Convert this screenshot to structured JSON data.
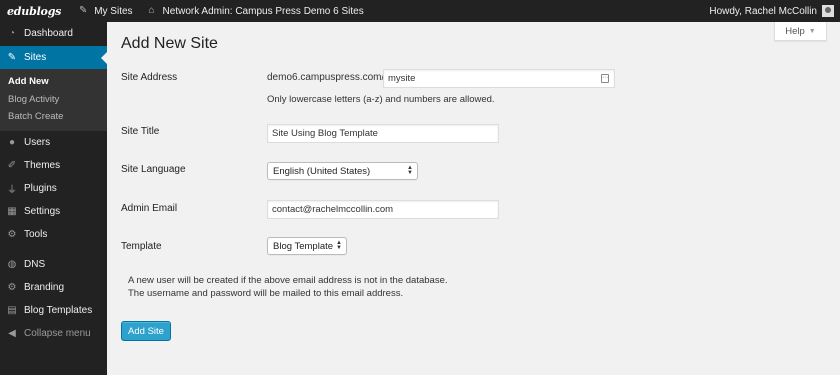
{
  "adminbar": {
    "logo": "edublogs",
    "my_sites": "My Sites",
    "network": "Network Admin: Campus Press Demo 6 Sites",
    "howdy": "Howdy, Rachel McCollin"
  },
  "sidebar": {
    "items": [
      {
        "label": "Dashboard",
        "icon": "dashboard-icon"
      },
      {
        "label": "Sites",
        "icon": "wrench-icon"
      },
      {
        "label": "Users",
        "icon": "user-icon"
      },
      {
        "label": "Themes",
        "icon": "paintbrush-icon"
      },
      {
        "label": "Plugins",
        "icon": "plug-icon"
      },
      {
        "label": "Settings",
        "icon": "settings-icon"
      },
      {
        "label": "Tools",
        "icon": "gear-icon"
      },
      {
        "label": "DNS",
        "icon": "globe-icon"
      },
      {
        "label": "Branding",
        "icon": "gear-icon"
      },
      {
        "label": "Blog Templates",
        "icon": "grid-icon"
      }
    ],
    "submenu": [
      "Add New",
      "Blog Activity",
      "Batch Create"
    ],
    "collapse": "Collapse menu"
  },
  "help": {
    "label": "Help"
  },
  "page": {
    "title": "Add New Site",
    "site_address_label": "Site Address",
    "site_address_prefix": "demo6.campuspress.com/",
    "site_address_value": "mysite",
    "site_address_hint": "Only lowercase letters (a-z) and numbers are allowed.",
    "site_title_label": "Site Title",
    "site_title_value": "Site Using Blog Template",
    "language_label": "Site Language",
    "language_value": "English (United States)",
    "admin_email_label": "Admin Email",
    "admin_email_value": "contact@rachelmccollin.com",
    "template_label": "Template",
    "template_value": "Blog Template",
    "note_line1": "A new user will be created if the above email address is not in the database.",
    "note_line2": "The username and password will be mailed to this email address.",
    "submit_label": "Add Site"
  },
  "colors": {
    "adminbar_bg": "#222222",
    "sidebar_bg": "#222222",
    "current_menu": "#0074a2",
    "primary_button": "#2ea2cc",
    "content_bg": "#f1f1f1"
  }
}
